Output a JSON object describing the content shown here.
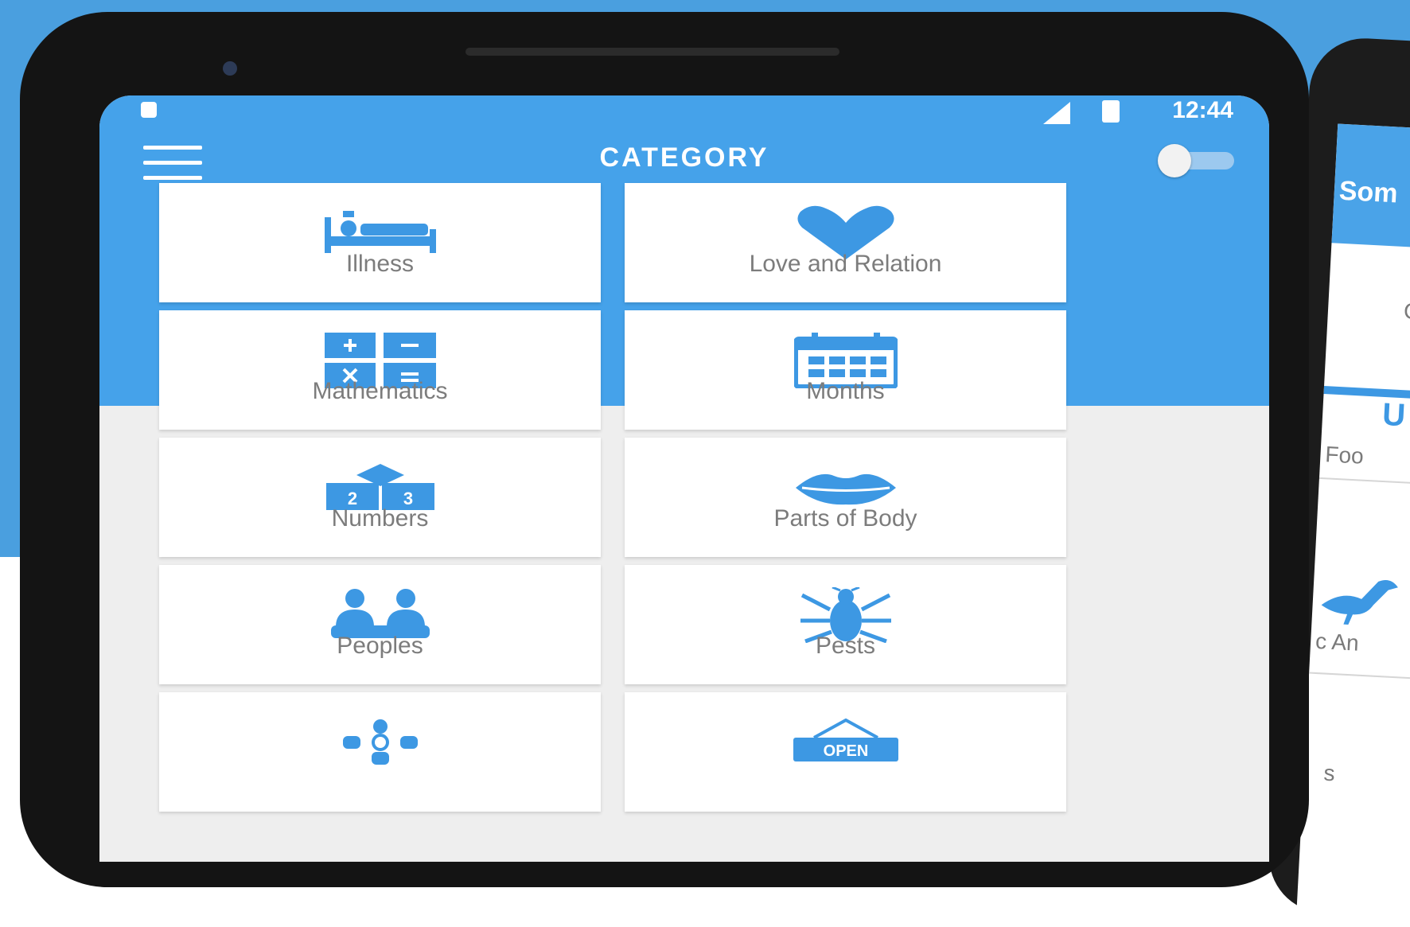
{
  "app": {
    "title": "CATEGORY",
    "appbar_label": "",
    "status_time": "12:44"
  },
  "categories": [
    {
      "label": "Illness",
      "icon": "hospital-bed-icon"
    },
    {
      "label": "Love and Relation",
      "icon": "heart-icon"
    },
    {
      "label": "Mathematics",
      "icon": "calculator-icon"
    },
    {
      "label": "Months",
      "icon": "calendar-icon"
    },
    {
      "label": "Numbers",
      "icon": "number-blocks-icon"
    },
    {
      "label": "Parts of Body",
      "icon": "lips-icon"
    },
    {
      "label": "Peoples",
      "icon": "people-icon"
    },
    {
      "label": "Pests",
      "icon": "insect-icon"
    },
    {
      "label": "",
      "icon": "shapes-icon"
    },
    {
      "label": "",
      "icon": "open-sign-icon"
    }
  ],
  "second_phone": {
    "title": "Som",
    "texts": [
      "C",
      "U",
      "Foo",
      "c An",
      "s"
    ]
  },
  "colors": {
    "background": "#4a9fdf",
    "accent": "#45a2ea",
    "icon": "#3d98e3",
    "label": "#7c7c7c"
  }
}
